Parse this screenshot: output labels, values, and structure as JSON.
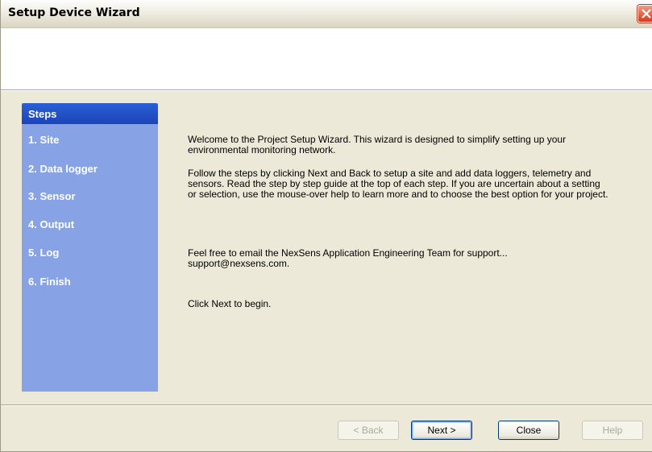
{
  "window": {
    "title": "Setup Device Wizard"
  },
  "steps": {
    "header": "Steps",
    "items": [
      {
        "label": "1. Site"
      },
      {
        "label": "2. Data logger"
      },
      {
        "label": "3. Sensor"
      },
      {
        "label": "4. Output"
      },
      {
        "label": "5. Log"
      },
      {
        "label": "6. Finish"
      }
    ]
  },
  "content": {
    "p1": "Welcome to the Project Setup Wizard. This wizard is designed to simplify setting up your environmental monitoring network.",
    "p2": "Follow the steps by clicking Next and Back to setup a site and add data loggers, telemetry and sensors. Read the step by step guide at the top of each step. If you are uncertain about a setting or selection, use the mouse-over help to learn more and to choose the best option for your project.",
    "p3": "Feel free to email the NexSens Application Engineering Team for support... support@nexsens.com.",
    "p4": "Click Next to begin."
  },
  "buttons": {
    "back": "< Back",
    "next": "Next >",
    "close": "Close",
    "help": "Help"
  }
}
